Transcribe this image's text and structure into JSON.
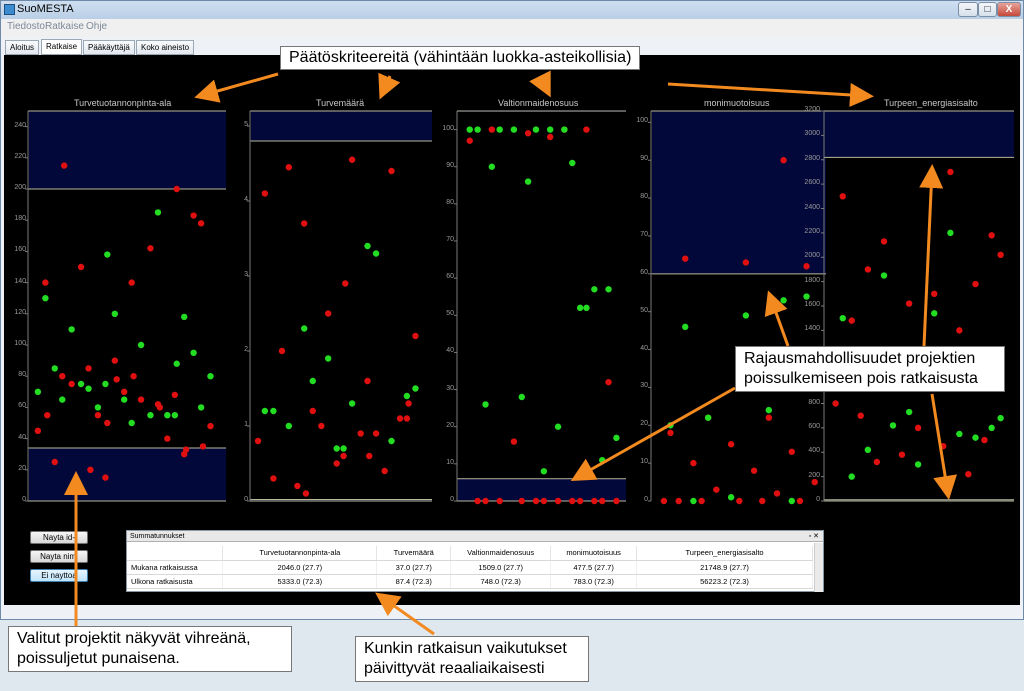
{
  "window": {
    "title": "SuoMESTA",
    "controls": [
      "–",
      "□",
      "X"
    ]
  },
  "menu": [
    "Tiedosto",
    "Ratkaise",
    "Ohje"
  ],
  "tabs": [
    {
      "label": "Aloitus"
    },
    {
      "label": "Ratkaise",
      "active": true
    },
    {
      "label": "Pääkäyttäjä"
    },
    {
      "label": "Koko aineisto"
    }
  ],
  "colors": {
    "selected": "#22dd22",
    "excluded": "#e01010",
    "band": "#03083a",
    "band_line": "#b8b89a"
  },
  "chart_data": [
    {
      "type": "scatter",
      "title": "Turvetuotannonpinta-ala",
      "ylim": [
        0,
        250
      ],
      "ticks": [
        0,
        20,
        40,
        60,
        80,
        100,
        120,
        140,
        160,
        180,
        200,
        220,
        240
      ],
      "exclusion_bands": [
        [
          0,
          34
        ],
        [
          200,
          250
        ]
      ],
      "selected": [
        [
          1,
          75
        ],
        [
          2,
          55
        ],
        [
          3,
          65
        ],
        [
          4,
          50
        ],
        [
          5,
          60
        ],
        [
          6,
          72
        ],
        [
          7,
          185
        ],
        [
          8,
          130
        ],
        [
          9,
          120
        ],
        [
          10,
          118
        ],
        [
          11,
          110
        ],
        [
          12,
          100
        ],
        [
          13,
          80
        ],
        [
          14,
          60
        ],
        [
          15,
          55
        ],
        [
          16,
          85
        ],
        [
          17,
          65
        ],
        [
          18,
          95
        ],
        [
          19,
          75
        ],
        [
          20,
          55
        ],
        [
          21,
          70
        ],
        [
          22,
          158
        ],
        [
          23,
          88
        ]
      ],
      "excluded": [
        [
          1,
          15
        ],
        [
          2,
          68
        ],
        [
          3,
          80
        ],
        [
          4,
          140
        ],
        [
          5,
          178
        ],
        [
          6,
          85
        ],
        [
          7,
          62
        ],
        [
          8,
          140
        ],
        [
          9,
          90
        ],
        [
          10,
          30
        ],
        [
          11,
          75
        ],
        [
          12,
          65
        ],
        [
          13,
          48
        ],
        [
          14,
          55
        ],
        [
          15,
          40
        ],
        [
          16,
          25
        ],
        [
          17,
          70
        ],
        [
          18,
          183
        ],
        [
          19,
          150
        ],
        [
          20,
          162
        ],
        [
          21,
          45
        ],
        [
          22,
          50
        ],
        [
          23,
          200
        ],
        [
          24,
          215
        ],
        [
          25,
          80
        ],
        [
          26,
          35
        ],
        [
          27,
          20
        ],
        [
          28,
          60
        ],
        [
          29,
          55
        ],
        [
          30,
          78
        ],
        [
          31,
          33
        ]
      ]
    },
    {
      "type": "scatter",
      "title": "Turvemäärä",
      "ylim": [
        0,
        5.2
      ],
      "ticks": [
        0,
        1,
        2,
        3,
        4,
        5
      ],
      "exclusion_bands": [
        [
          0,
          0.02
        ],
        [
          4.8,
          5.2
        ]
      ],
      "selected": [
        [
          1,
          0.7
        ],
        [
          2,
          1.4
        ],
        [
          3,
          2.3
        ],
        [
          4,
          3.4
        ],
        [
          5,
          1.2
        ],
        [
          6,
          1.9
        ],
        [
          7,
          0.8
        ],
        [
          8,
          1.0
        ],
        [
          9,
          1.3
        ],
        [
          10,
          1.5
        ],
        [
          11,
          1.6
        ],
        [
          12,
          3.3
        ],
        [
          13,
          1.2
        ],
        [
          14,
          0.7
        ]
      ],
      "excluded": [
        [
          1,
          0.6
        ],
        [
          2,
          1.1
        ],
        [
          3,
          3.7
        ],
        [
          4,
          1.6
        ],
        [
          5,
          4.1
        ],
        [
          6,
          2.5
        ],
        [
          7,
          4.4
        ],
        [
          8,
          4.45
        ],
        [
          9,
          4.55
        ],
        [
          10,
          2.2
        ],
        [
          11,
          1.2
        ],
        [
          12,
          0.9
        ],
        [
          13,
          0.3
        ],
        [
          14,
          0.5
        ],
        [
          15,
          1.1
        ],
        [
          16,
          0.2
        ],
        [
          17,
          0.9
        ],
        [
          18,
          0.8
        ],
        [
          19,
          1.0
        ],
        [
          20,
          0.4
        ],
        [
          21,
          2.0
        ],
        [
          22,
          2.9
        ],
        [
          23,
          1.3
        ],
        [
          24,
          0.1
        ],
        [
          25,
          0.6
        ]
      ]
    },
    {
      "type": "scatter",
      "title": "Valtionmaidenosuus",
      "ylim": [
        0,
        105
      ],
      "ticks": [
        0,
        10,
        20,
        30,
        40,
        50,
        60,
        70,
        80,
        90,
        100
      ],
      "exclusion_bands": [
        [
          0,
          6
        ],
        [
          105,
          110
        ]
      ],
      "selected": [
        [
          1,
          100
        ],
        [
          2,
          100
        ],
        [
          3,
          86
        ],
        [
          4,
          52
        ],
        [
          5,
          90
        ],
        [
          6,
          100
        ],
        [
          7,
          57
        ],
        [
          8,
          100
        ],
        [
          9,
          91
        ],
        [
          10,
          100
        ],
        [
          11,
          100
        ],
        [
          12,
          57
        ],
        [
          13,
          100
        ],
        [
          14,
          20
        ],
        [
          15,
          17
        ],
        [
          16,
          28
        ],
        [
          17,
          52
        ],
        [
          18,
          26
        ],
        [
          19,
          8
        ],
        [
          20,
          11
        ]
      ],
      "excluded": [
        [
          1,
          100
        ],
        [
          2,
          97
        ],
        [
          3,
          99
        ],
        [
          4,
          100
        ],
        [
          5,
          100
        ],
        [
          6,
          98
        ],
        [
          7,
          32
        ],
        [
          8,
          16
        ],
        [
          9,
          0
        ],
        [
          10,
          0
        ],
        [
          11,
          0
        ],
        [
          12,
          0
        ],
        [
          13,
          0
        ],
        [
          14,
          0
        ],
        [
          15,
          0
        ],
        [
          16,
          0
        ],
        [
          17,
          0
        ],
        [
          18,
          0
        ],
        [
          19,
          0
        ],
        [
          20,
          0
        ]
      ]
    },
    {
      "type": "scatter",
      "title": "monimuotoisuus",
      "ylim": [
        0,
        103
      ],
      "ticks": [
        0,
        10,
        20,
        30,
        40,
        50,
        60,
        70,
        80,
        90,
        100
      ],
      "exclusion_bands": [
        [
          60,
          103
        ]
      ],
      "selected": [
        [
          1,
          53
        ],
        [
          2,
          46
        ],
        [
          3,
          49
        ],
        [
          4,
          54
        ],
        [
          5,
          22
        ],
        [
          6,
          24
        ],
        [
          7,
          20
        ],
        [
          8,
          1
        ],
        [
          9,
          0
        ],
        [
          10,
          0
        ]
      ],
      "excluded": [
        [
          1,
          90
        ],
        [
          2,
          64
        ],
        [
          3,
          63
        ],
        [
          4,
          62
        ],
        [
          5,
          22
        ],
        [
          6,
          22
        ],
        [
          7,
          18
        ],
        [
          8,
          15
        ],
        [
          9,
          13
        ],
        [
          10,
          10
        ],
        [
          11,
          8
        ],
        [
          12,
          5
        ],
        [
          13,
          3
        ],
        [
          14,
          2
        ],
        [
          15,
          0
        ],
        [
          16,
          0
        ],
        [
          17,
          0
        ],
        [
          18,
          0
        ],
        [
          19,
          0
        ],
        [
          20,
          0
        ]
      ]
    },
    {
      "type": "scatter",
      "title": "Turpeen_energiasisalto",
      "ylim": [
        0,
        3200
      ],
      "ticks": [
        0,
        200,
        400,
        600,
        800,
        1000,
        1200,
        1400,
        1600,
        1800,
        2000,
        2200,
        2400,
        2600,
        2800,
        3000,
        3200
      ],
      "exclusion_bands": [
        [
          0,
          10
        ],
        [
          2820,
          3200
        ]
      ],
      "selected": [
        [
          1,
          600
        ],
        [
          2,
          1850
        ],
        [
          3,
          2200
        ],
        [
          4,
          1500
        ],
        [
          5,
          730
        ],
        [
          6,
          520
        ],
        [
          7,
          420
        ],
        [
          8,
          1540
        ],
        [
          9,
          680
        ],
        [
          10,
          620
        ],
        [
          11,
          550
        ],
        [
          12,
          200
        ],
        [
          13,
          300
        ]
      ],
      "excluded": [
        [
          1,
          2180
        ],
        [
          2,
          2130
        ],
        [
          3,
          2700
        ],
        [
          4,
          2500
        ],
        [
          5,
          1620
        ],
        [
          6,
          1780
        ],
        [
          7,
          1900
        ],
        [
          8,
          1700
        ],
        [
          9,
          2020
        ],
        [
          10,
          1180
        ],
        [
          11,
          1400
        ],
        [
          12,
          1480
        ],
        [
          13,
          600
        ],
        [
          14,
          500
        ],
        [
          15,
          320
        ],
        [
          16,
          450
        ],
        [
          17,
          800
        ],
        [
          18,
          380
        ],
        [
          19,
          220
        ],
        [
          20,
          700
        ]
      ]
    }
  ],
  "buttons": {
    "show_id": "Nayta id-numero",
    "show_name": "Nayta nimi",
    "dont_show": "Ei nayttoa"
  },
  "summary": {
    "title": "Summatunnukset",
    "columns": [
      "",
      "Turvetuotannonpinta-ala",
      "Turvemäärä",
      "Valtionmaidenosuus",
      "monimuotoisuus",
      "Turpeen_energiasisalto"
    ],
    "rows": [
      [
        "Mukana ratkaisussa",
        "2046.0 (27.7)",
        "37.0 (27.7)",
        "1509.0 (27.7)",
        "477.5 (27.7)",
        "21748.9 (27.7)"
      ],
      [
        "Ulkona ratkaisusta",
        "5333.0 (72.3)",
        "87.4 (72.3)",
        "748.0 (72.3)",
        "783.0 (72.3)",
        "56223.2 (72.3)"
      ]
    ]
  },
  "annotations": {
    "criteria": "Päätöskriteereitä (vähintään luokka-asteikollisia)",
    "limits": "Rajausmahdollisuudet  projektien poissulkemiseen pois ratkaisusta",
    "selected": "Valitut projektit näkyvät vihreänä, poissuljetut punaisena.",
    "effects": "Kunkin ratkaisun vaikutukset päivittyvät reaaliaikaisesti"
  }
}
